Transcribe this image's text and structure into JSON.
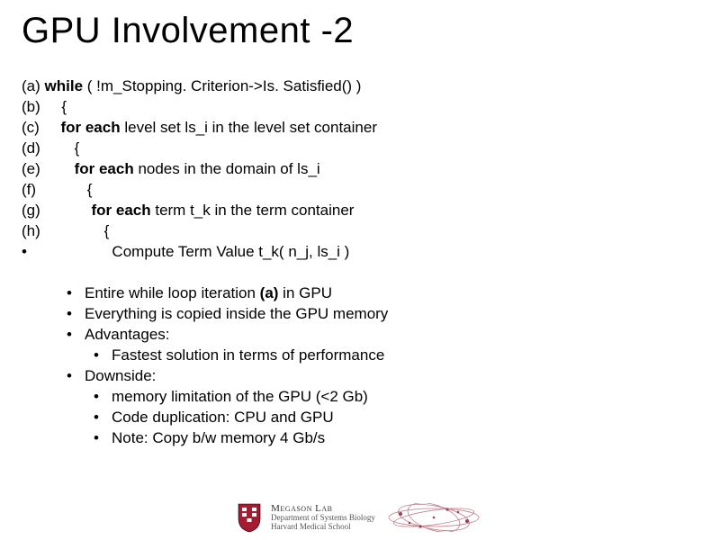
{
  "title": "GPU Involvement -2",
  "code": {
    "a": {
      "label": "(a)",
      "pre": "",
      "kw": "while",
      "post": " ( !m_Stopping. Criterion->Is. Satisfied() )"
    },
    "b": {
      "label": "(b)",
      "pre": "    ",
      "kw": "",
      "post": "{"
    },
    "c": {
      "label": "(c)",
      "pre": "    ",
      "kw": "for each",
      "post": " level set ls_i in the level set container"
    },
    "d": {
      "label": "(d)",
      "pre": "       ",
      "kw": "",
      "post": "{"
    },
    "e": {
      "label": "(e)",
      "pre": "       ",
      "kw": "for each",
      "post": " nodes in the domain of ls_i"
    },
    "f": {
      "label": "(f)",
      "pre": "           ",
      "kw": "",
      "post": "{"
    },
    "g": {
      "label": "(g)",
      "pre": "           ",
      "kw": "for each",
      "post": " term t_k in the term container"
    },
    "h": {
      "label": "(h)",
      "pre": "              ",
      "kw": "",
      "post": "{"
    },
    "i": {
      "label": "•",
      "pre": "                 ",
      "kw": "",
      "post": "Compute Term Value t_k( n_j, ls_i )"
    }
  },
  "bullets": {
    "l1a_pre": "Entire while loop iteration ",
    "l1a_bold": "(a)",
    "l1a_post": " in GPU",
    "l2": "Everything is copied inside the GPU memory",
    "l3": "Advantages:",
    "l3a": "Fastest solution in terms of performance",
    "l4": "Downside:",
    "l4a": "memory limitation of the GPU (<2 Gb)",
    "l4b": "Code duplication: CPU and GPU",
    "l4c": "Note: Copy b/w memory 4 Gb/s"
  },
  "footer": {
    "lab": "Megason Lab",
    "dept": "Department of Systems Biology",
    "school": "Harvard Medical School"
  }
}
